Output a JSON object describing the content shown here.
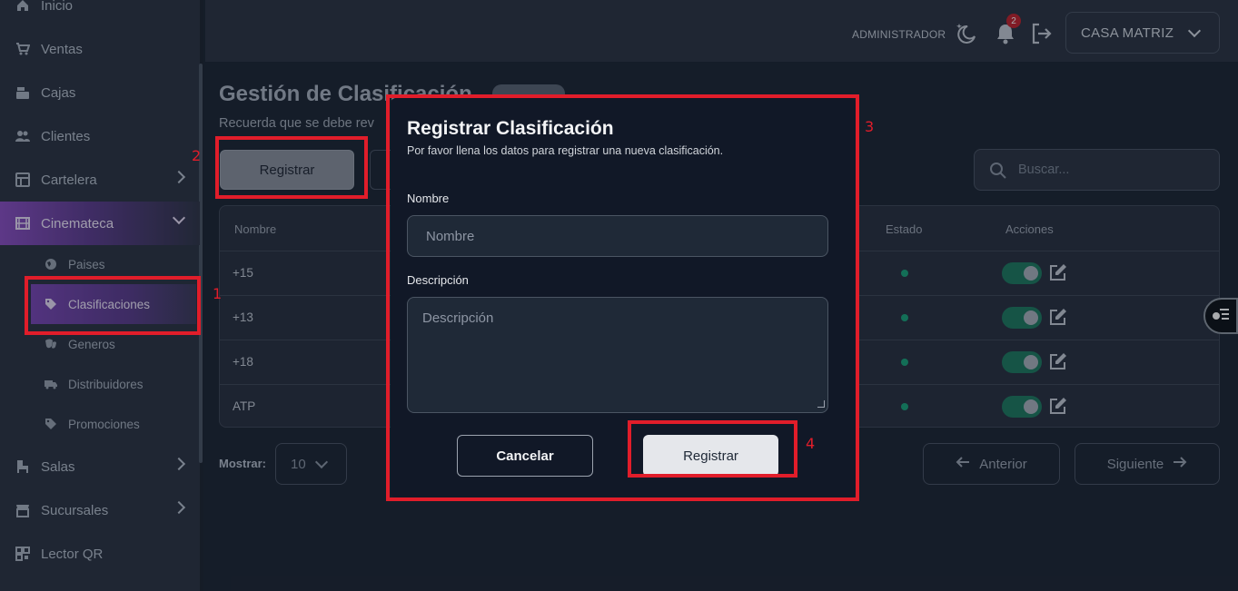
{
  "sidebar": {
    "items": [
      {
        "label": "Inicio",
        "icon": "home-icon"
      },
      {
        "label": "Ventas",
        "icon": "cart-icon"
      },
      {
        "label": "Cajas",
        "icon": "cash-register-icon"
      },
      {
        "label": "Clientes",
        "icon": "users-icon"
      },
      {
        "label": "Cartelera",
        "icon": "board-icon"
      },
      {
        "label": "Cinemateca",
        "icon": "film-icon"
      }
    ],
    "sub_items": [
      {
        "label": "Paises",
        "icon": "globe-icon"
      },
      {
        "label": "Clasificaciones",
        "icon": "tags-icon"
      },
      {
        "label": "Generos",
        "icon": "masks-icon"
      },
      {
        "label": "Distribuidores",
        "icon": "truck-icon"
      },
      {
        "label": "Promociones",
        "icon": "tag-icon"
      }
    ],
    "bottom_items": [
      {
        "label": "Salas",
        "icon": "chair-icon"
      },
      {
        "label": "Sucursales",
        "icon": "store-icon"
      },
      {
        "label": "Lector QR",
        "icon": "qr-icon"
      }
    ]
  },
  "header": {
    "role": "ADMINISTRADOR",
    "notifications": "2",
    "branch": "CASA MATRIZ"
  },
  "page": {
    "title": "Gestión de Clasificación",
    "subtitle": "Recuerda que se debe rev",
    "register_button": "Registrar",
    "search_placeholder": "Buscar..."
  },
  "table": {
    "columns": [
      "Nombre",
      "Estado",
      "Acciones"
    ],
    "rows": [
      {
        "name": "+15"
      },
      {
        "name": "+13"
      },
      {
        "name": "+18"
      },
      {
        "name": "ATP"
      }
    ]
  },
  "pagination": {
    "show_label": "Mostrar:",
    "page_size": "10",
    "prev": "Anterior",
    "next": "Siguiente"
  },
  "modal": {
    "title": "Registrar Clasificación",
    "subtitle": "Por favor llena los datos para registrar una nueva clasificación.",
    "name_label": "Nombre",
    "name_placeholder": "Nombre",
    "desc_label": "Descripción",
    "desc_placeholder": "Descripción",
    "cancel": "Cancelar",
    "submit": "Registrar"
  },
  "annotations": [
    "1",
    "2",
    "3",
    "4"
  ],
  "colors": {
    "accent_purple": "#8b4fc4",
    "annotation_red": "#e11d2a",
    "status_green": "#1aa37a"
  }
}
